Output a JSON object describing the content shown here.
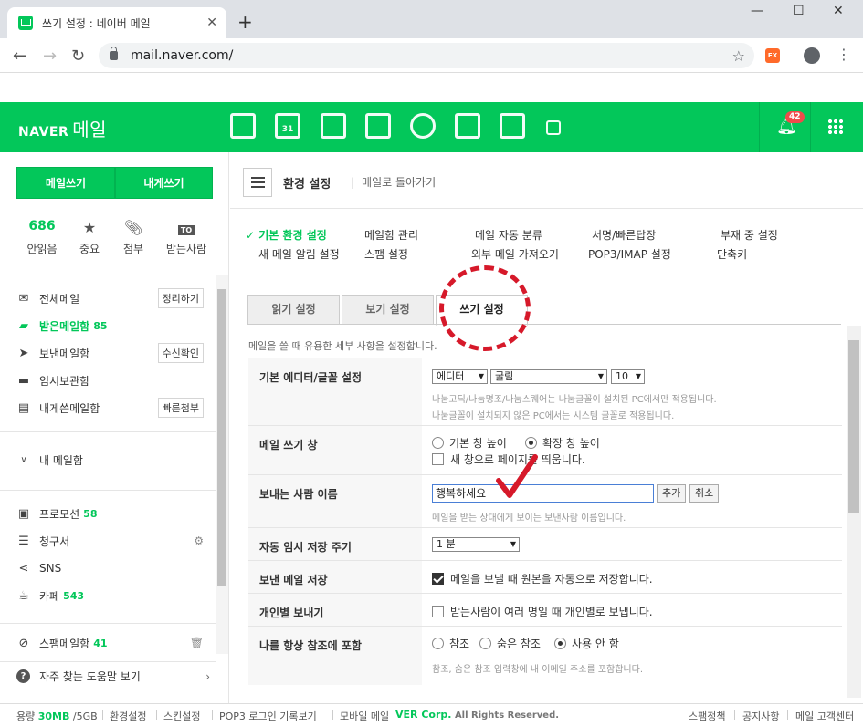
{
  "browser": {
    "tab_title": "쓰기 설정 : 네이버 메일",
    "url": "mail.naver.com/"
  },
  "header": {
    "logo": "NAVER",
    "logo_service": "메일",
    "notification_count": "42",
    "app_icons": [
      "mail-home-icon",
      "calendar-icon",
      "memo-icon",
      "contacts-icon",
      "cloud-icon",
      "office-icon",
      "blog-icon",
      "more-apps-icon"
    ],
    "calendar_day": "31"
  },
  "sidebar": {
    "write_button": "메일쓰기",
    "write_self_button": "내게쓰기",
    "stats": [
      {
        "value": "686",
        "label": "안읽음"
      },
      {
        "value": "",
        "label": "중요"
      },
      {
        "value": "",
        "label": "첨부"
      },
      {
        "value": "TO",
        "label": "받는사람"
      }
    ],
    "mailboxes": [
      {
        "name": "전체메일",
        "count": "",
        "button": "정리하기"
      },
      {
        "name": "받은메일함",
        "count": "85",
        "button": ""
      },
      {
        "name": "보낸메일함",
        "count": "",
        "button": "수신확인"
      },
      {
        "name": "임시보관함",
        "count": "",
        "button": ""
      },
      {
        "name": "내게쓴메일함",
        "count": "",
        "button": "빠른첨부"
      }
    ],
    "my_mailbox": "내 메일함",
    "extras": [
      {
        "name": "프로모션",
        "count": "58"
      },
      {
        "name": "청구서",
        "count": ""
      },
      {
        "name": "SNS",
        "count": ""
      },
      {
        "name": "카페",
        "count": "543"
      }
    ],
    "spam": {
      "name": "스팸메일함",
      "count": "41"
    },
    "help": "자주 찾는 도움말 보기"
  },
  "main": {
    "title": "환경 설정",
    "back_link": "메일로 돌아가기",
    "settings_links": [
      "기본 환경 설정",
      "메일함 관리",
      "메일 자동 분류",
      "서명/빠른답장",
      "부재 중 설정",
      "새 메일 알림 설정",
      "스팸 설정",
      "외부 메일 가져오기",
      "POP3/IMAP 설정",
      "단축키"
    ],
    "tabs": [
      "읽기 설정",
      "보기 설정",
      "쓰기 설정"
    ],
    "active_tab": "쓰기 설정",
    "intro": "메일을 쓸 때 유용한 세부 사항을 설정합니다.",
    "rows": {
      "editor": {
        "label": "기본 에디터/글꼴 설정",
        "editor_value": "에디터",
        "font_value": "굴림",
        "size_value": "10",
        "hint1": "나눔고딕/나눔명조/나눔스퀘어는 나눔글꼴이 설치된 PC에서만 적용됩니다.",
        "hint2": "나눔글꼴이 설치되지 않은 PC에서는 시스템 글꼴로 적용됩니다."
      },
      "window": {
        "label": "메일 쓰기 창",
        "opt1": "기본 창 높이",
        "opt2": "확장 창 높이",
        "newwin": "새 창으로 페이지를 띄웁니다."
      },
      "sender": {
        "label": "보내는 사람 이름",
        "value": "행복하세요",
        "add": "추가",
        "cancel": "취소",
        "hint": "메일을 받는 상대에게 보이는 보낸사람 이름입니다."
      },
      "autosave": {
        "label": "자동 임시 저장 주기",
        "value": "1 분"
      },
      "savesent": {
        "label": "보낸 메일 저장",
        "text": "메일을 보낼 때 원본을 자동으로 저장합니다."
      },
      "individual": {
        "label": "개인별 보내기",
        "text": "받는사람이 여러 명일 때 개인별로 보냅니다."
      },
      "cc": {
        "label": "나를 항상 참조에 포함",
        "opt1": "참조",
        "opt2": "숨은 참조",
        "opt3": "사용 안 함",
        "hint": "참조, 숨은 참조 입력창에 내 이메일 주소를 포함합니다."
      }
    }
  },
  "footer": {
    "usage_label": "용량",
    "usage_value": "30MB",
    "usage_total": "/5GB",
    "links": [
      "환경설정",
      "스킨설정",
      "POP3 로그인 기록보기",
      "모바일 메일"
    ],
    "copyright_corp": "VER Corp.",
    "copyright_rest": "All Rights Reserved.",
    "right_links": [
      "스팸정책",
      "공지사항",
      "메일 고객센터"
    ]
  },
  "colors": {
    "brand": "#03c75a",
    "annotation": "#d6192a"
  }
}
